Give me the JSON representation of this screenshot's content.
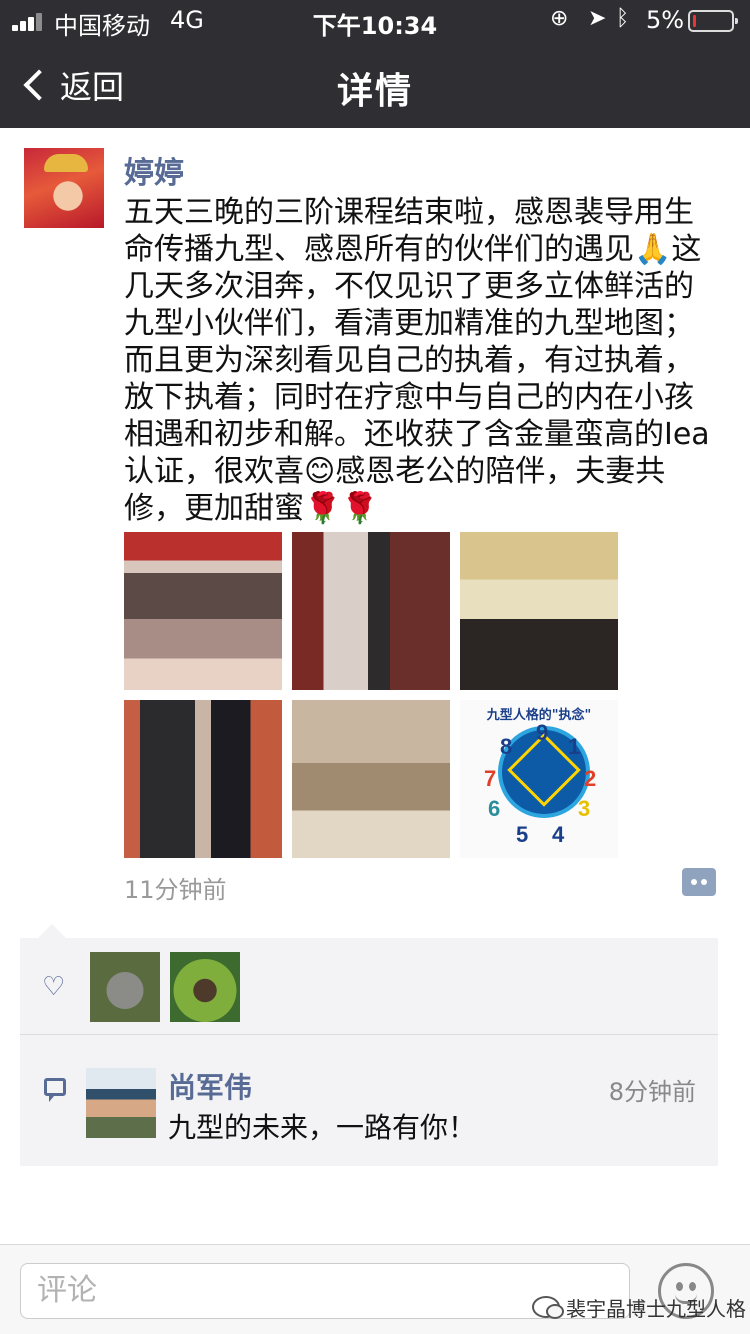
{
  "status_bar": {
    "carrier": "中国移动",
    "network": "4G",
    "time": "下午10:34",
    "battery": "5%",
    "battery_level": 0.05
  },
  "nav": {
    "back_label": "返回",
    "title": "详情"
  },
  "post": {
    "author": "婷婷",
    "text": "五天三晚的三阶课程结束啦，感恩裴导用生命传播九型、感恩所有的伙伴们的遇见🙏这几天多次泪奔，不仅见识了更多立体鲜活的九型小伙伴们，看清更加精准的九型地图；而且更为深刻看见自己的执着，有过执着，放下执着；同时在疗愈中与自己的内在小孩相遇和初步和解。还收获了含金量蛮高的Iea认证，很欢喜😊感恩老公的陪伴，夫妻共修，更加甜蜜🌹🌹",
    "time": "11分钟前",
    "photos": [
      {
        "name": "group-photo"
      },
      {
        "name": "couple-photo"
      },
      {
        "name": "certificate-photo"
      },
      {
        "name": "couple-standing-photo"
      },
      {
        "name": "hug-photo"
      },
      {
        "name": "enneagram-chart-photo",
        "title": "九型人格的\"执念\"",
        "numbers": [
          "9",
          "1",
          "2",
          "3",
          "4",
          "5",
          "6",
          "7",
          "8"
        ]
      }
    ]
  },
  "interactions": {
    "likes": [
      {
        "name": "koala-avatar"
      },
      {
        "name": "cartoon-avatar"
      }
    ],
    "comments": [
      {
        "author": "尚军伟",
        "time": "8分钟前",
        "text": "九型的未来，一路有你！"
      }
    ]
  },
  "comment_bar": {
    "placeholder": "评论"
  },
  "watermark": {
    "text": "裴宇晶博士九型人格"
  },
  "colors": {
    "nav_bg": "#2f2f33",
    "link_blue": "#576b95",
    "panel_bg": "#f3f3f5"
  }
}
